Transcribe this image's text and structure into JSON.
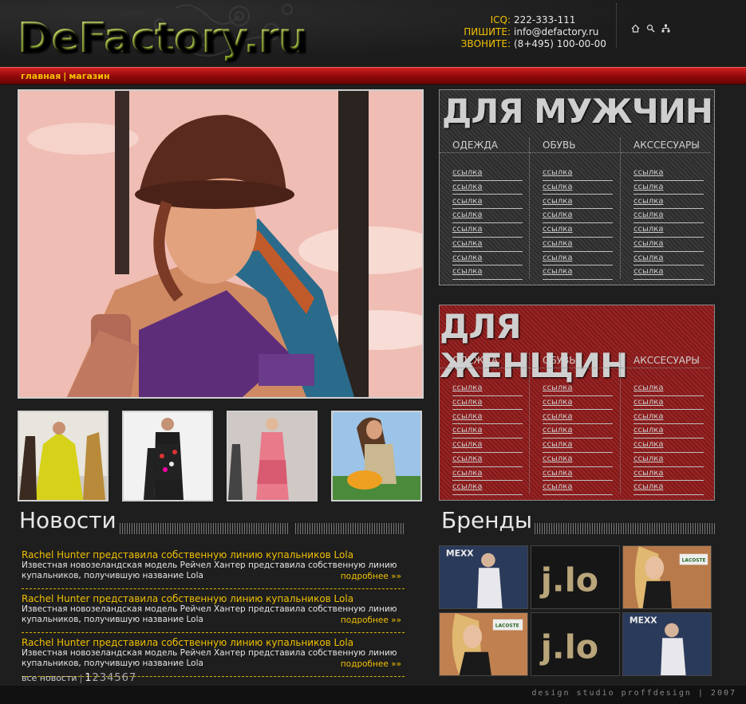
{
  "header": {
    "logo": "DeFactory.ru",
    "contacts": [
      {
        "label": "ICQ:",
        "value": "222-333-111"
      },
      {
        "label": "ПИШИТЕ:",
        "value": "info@defactory.ru"
      },
      {
        "label": "ЗВОНИТЕ:",
        "value": "(8+495) 100-00-00"
      }
    ],
    "icons": [
      "home-icon",
      "search-icon",
      "sitemap-icon"
    ]
  },
  "nav": {
    "items": [
      "главная",
      "магазин"
    ],
    "separator": "|"
  },
  "panels": {
    "men": {
      "title": "ДЛЯ МУЖЧИН",
      "columns": [
        {
          "heading": "ОДЕЖДА",
          "links": [
            "ссылка",
            "ссылка",
            "ссылка",
            "ссылка",
            "ссылка",
            "ссылка",
            "ссылка",
            "ссылка"
          ]
        },
        {
          "heading": "ОБУВЬ",
          "links": [
            "ссылка",
            "ссылка",
            "ссылка",
            "ссылка",
            "ссылка",
            "ссылка",
            "ссылка",
            "ссылка"
          ]
        },
        {
          "heading": "АКССЕСУАРЫ",
          "links": [
            "ссылка",
            "ссылка",
            "ссылка",
            "ссылка",
            "ссылка",
            "ссылка",
            "ссылка",
            "ссылка"
          ]
        }
      ]
    },
    "women": {
      "title": "ДЛЯ ЖЕНЩИН",
      "columns": [
        {
          "heading": "ОДЕЖДА",
          "links": [
            "ссылка",
            "ссылка",
            "ссылка",
            "ссылка",
            "ссылка",
            "ссылка",
            "ссылка",
            "ссылка"
          ]
        },
        {
          "heading": "ОБУВЬ",
          "links": [
            "ссылка",
            "ссылка",
            "ссылка",
            "ссылка",
            "ссылка",
            "ссылка",
            "ссылка",
            "ссылка"
          ]
        },
        {
          "heading": "АКССЕСУАРЫ",
          "links": [
            "ссылка",
            "ссылка",
            "ссылка",
            "ссылка",
            "ссылка",
            "ссылка",
            "ссылка",
            "ссылка"
          ]
        }
      ]
    }
  },
  "news": {
    "title": "Новости",
    "items": [
      {
        "title": "Rachel Hunter представила собственную линию купальников Lola",
        "text": "Известная новозеландская модель Рейчел Хантер представила собственную линию купальников, получившую название Lola",
        "more": "подробнее »»"
      },
      {
        "title": "Rachel Hunter представила собственную линию купальников Lola",
        "text": "Известная новозеландская модель Рейчел Хантер представила собственную линию купальников, получившую название Lola",
        "more": "подробнее »»"
      },
      {
        "title": "Rachel Hunter представила собственную линию купальников Lola",
        "text": "Известная новозеландская модель Рейчел Хантер представила собственную линию купальников, получившую название Lola",
        "more": "подробнее »»"
      }
    ],
    "all_label": "все новости",
    "pager_sep": "|",
    "pages": [
      "1",
      "2",
      "3",
      "4",
      "5",
      "6",
      "7"
    ]
  },
  "brands": {
    "title": "Бренды",
    "logos": [
      "MEXX",
      "j.lo",
      "LACOSTE",
      "LACOSTE",
      "j.lo",
      "MEXX"
    ]
  },
  "footer": "design studio proffdesign | 2007",
  "colors": {
    "accent_yellow": "#f0c000",
    "logo_green": "#b9d84a",
    "nav_red": "#a80f0f",
    "women_red": "#8c1f1f"
  }
}
